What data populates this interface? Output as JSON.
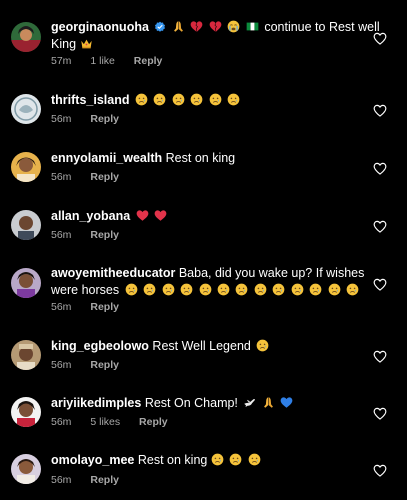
{
  "comments": [
    {
      "username": "georginaonuoha",
      "verified": true,
      "text_line1": "continue to Rest well",
      "text_line2": "King",
      "emojis_line1": [
        "folded-hands",
        "broken-heart",
        "broken-heart",
        "crying-face",
        "nigeria-flag"
      ],
      "emojis_line2": [
        "crown"
      ],
      "time": "57m",
      "likes": "1 like",
      "reply": "Reply"
    },
    {
      "username": "thrifts_island",
      "text": "",
      "emojis": [
        "sad-tear-face",
        "sad-tear-face",
        "sad-tear-face",
        "sad-tear-face",
        "sad-tear-face",
        "sad-tear-face"
      ],
      "time": "56m",
      "reply": "Reply"
    },
    {
      "username": "ennyolamii_wealth",
      "text": "Rest on king",
      "time": "56m",
      "reply": "Reply"
    },
    {
      "username": "allan_yobana",
      "text": "",
      "emojis": [
        "red-heart",
        "red-heart"
      ],
      "time": "56m",
      "reply": "Reply"
    },
    {
      "username": "awoyemitheeducator",
      "text_line1": "Baba, did you wake up? If wishes",
      "text_line2": "were horses",
      "emojis_line2": [
        "sad-tear-face",
        "sad-tear-face",
        "sad-tear-face",
        "sad-tear-face",
        "sad-tear-face",
        "sad-tear-face",
        "sad-tear-face",
        "sad-tear-face",
        "sad-tear-face",
        "sad-tear-face",
        "sad-tear-face",
        "sad-tear-face",
        "sad-tear-face"
      ],
      "time": "56m",
      "reply": "Reply"
    },
    {
      "username": "king_egbeolowo",
      "text": "Rest Well Legend",
      "emojis": [
        "sad-tear-face"
      ],
      "time": "56m",
      "reply": "Reply"
    },
    {
      "username": "ariyiikedimples",
      "text": "Rest On Champ!",
      "emojis": [
        "dove",
        "folded-hands",
        "blue-heart"
      ],
      "time": "56m",
      "likes": "5 likes",
      "reply": "Reply"
    },
    {
      "username": "omolayo_mee",
      "text": "Rest on king",
      "emojis": [
        "sad-tear-face",
        "sad-tear-face",
        "sad-tear-face"
      ],
      "time": "56m",
      "reply": "Reply"
    }
  ],
  "colors": {
    "background": "#000000",
    "text": "#ffffff",
    "secondary_text": "#a8a8a8",
    "verified_badge": "#3897f0"
  },
  "icons": {
    "like": "heart-outline-icon",
    "verified": "verified-badge-icon"
  }
}
